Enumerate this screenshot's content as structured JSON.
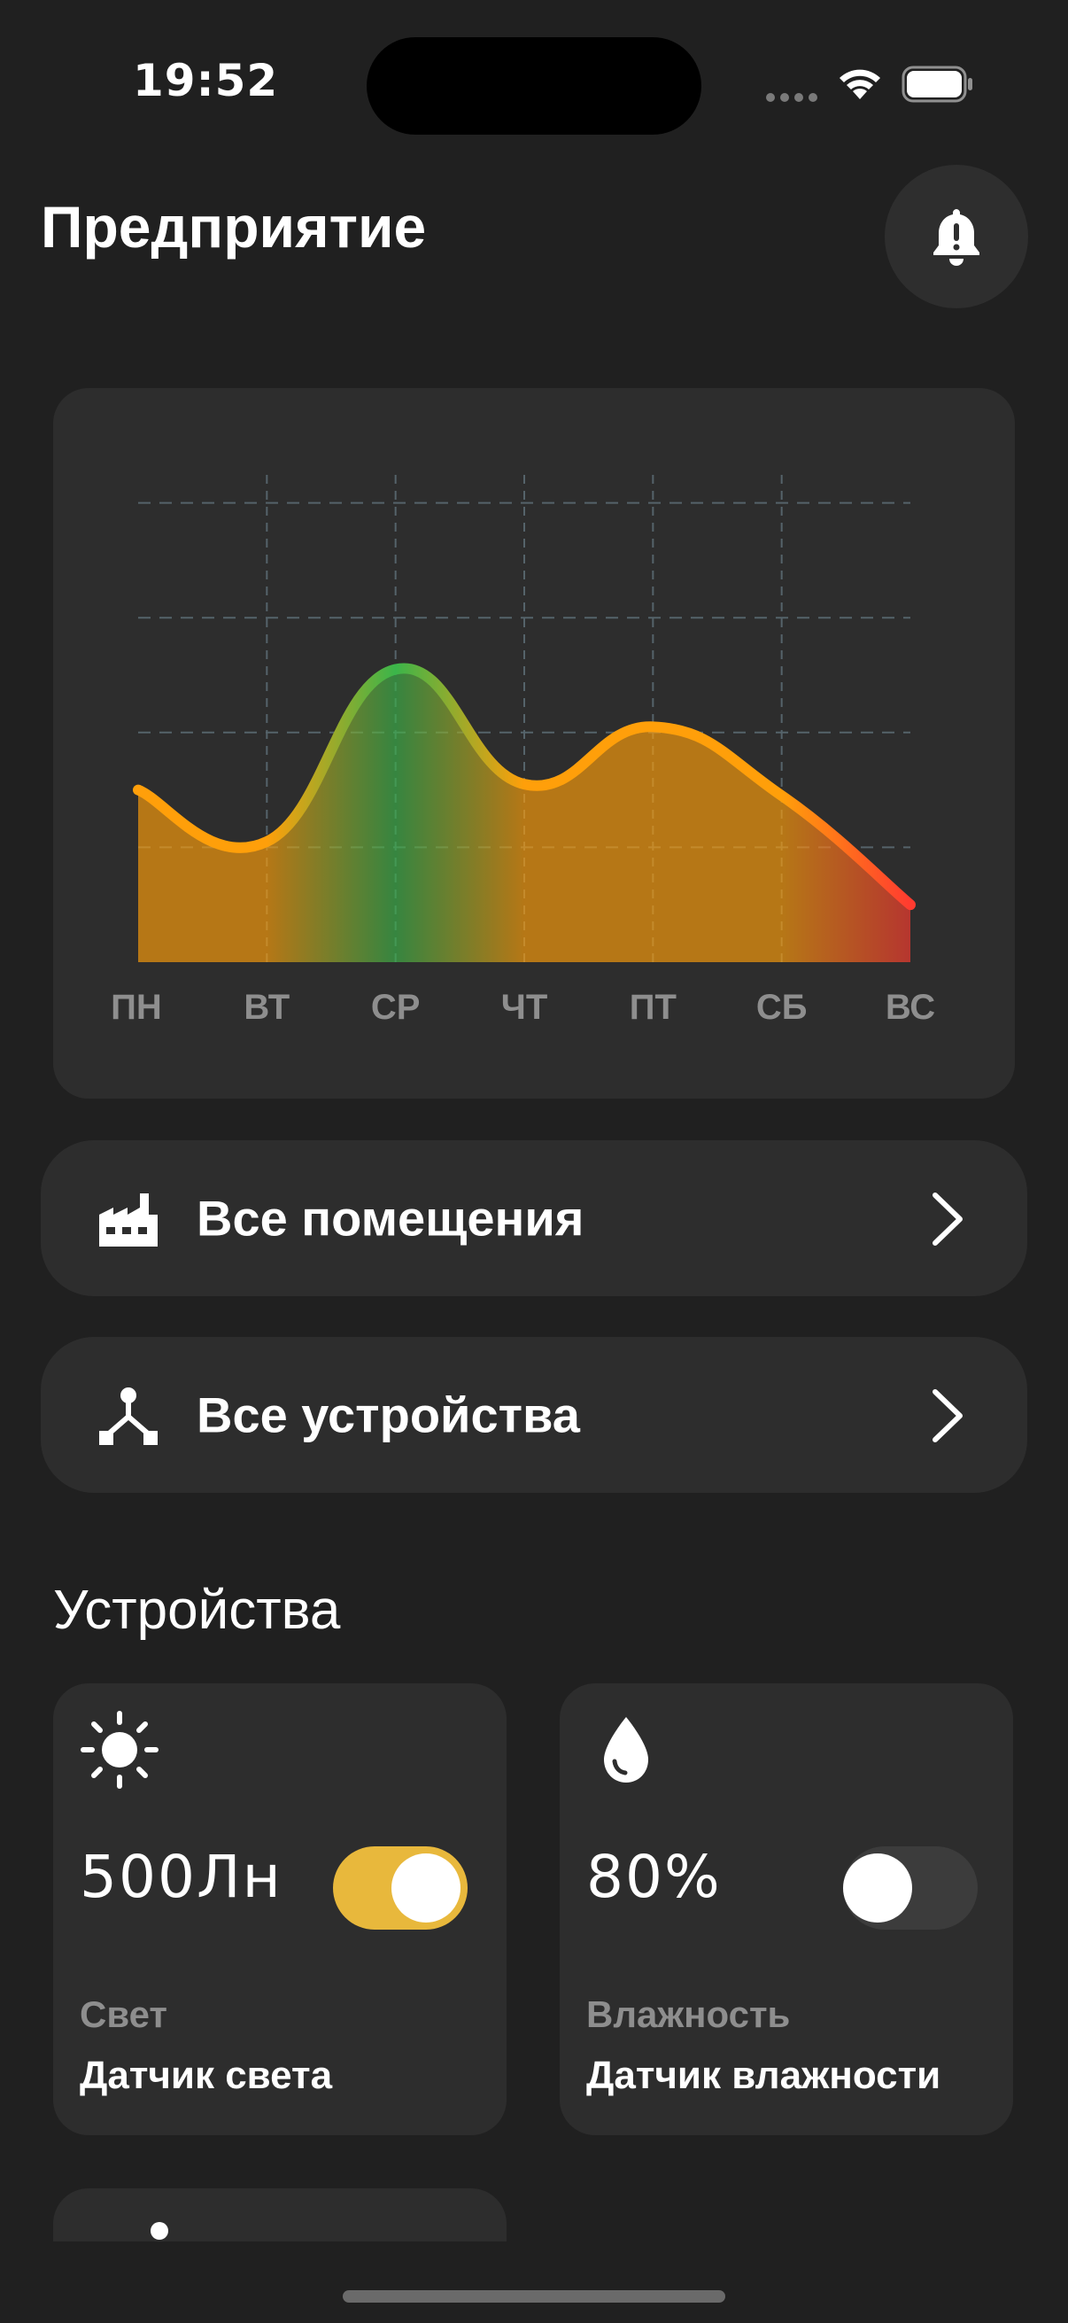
{
  "status_bar": {
    "time": "19:52",
    "icons": [
      "signal-dots-icon",
      "wifi-icon",
      "battery-icon"
    ]
  },
  "header": {
    "title": "Предприятие",
    "bell_icon": "bell-alert-icon"
  },
  "chart_data": {
    "type": "area",
    "categories": [
      "ПН",
      "ВТ",
      "СР",
      "ЧТ",
      "ПТ",
      "СБ",
      "ВС"
    ],
    "values": [
      1.5,
      1.05,
      2.55,
      1.55,
      2.05,
      1.45,
      0.5
    ],
    "ylim": [
      0,
      5
    ],
    "grid": true,
    "colors": {
      "low": "#ff3b30",
      "mid": "#ff9f0a",
      "high": "#3bb54a"
    }
  },
  "navigation": {
    "rooms": {
      "label": "Все помещения",
      "icon": "factory-icon"
    },
    "devices": {
      "label": "Все устройства",
      "icon": "network-nodes-icon"
    }
  },
  "devices_section": {
    "title": "Устройства",
    "cards": [
      {
        "icon": "sun-icon",
        "value": "500Лн",
        "toggle_on": true,
        "category": "Свет",
        "name": "Датчик света"
      },
      {
        "icon": "water-drop-icon",
        "value": "80%",
        "toggle_on": false,
        "category": "Влажность",
        "name": "Датчик влажности"
      }
    ]
  },
  "accent_color": "#e8b83c"
}
